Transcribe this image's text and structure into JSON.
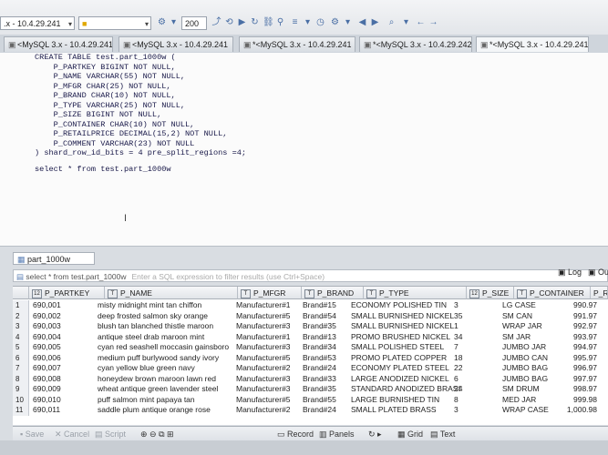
{
  "toolbar": {
    "connection_combo": ".x - 10.4.29.241",
    "database_combo": "",
    "limit_value": "200"
  },
  "tabs": [
    {
      "label": "<MySQL 3.x - 10.4.29.241"
    },
    {
      "label": "<MySQL 3.x - 10.4.29.241"
    },
    {
      "label": "*<MySQL 3.x - 10.4.29.241"
    },
    {
      "label": "*<MySQL 3.x - 10.4.29.242"
    },
    {
      "label": "*<MySQL 3.x - 10.4.29.241"
    }
  ],
  "editor": {
    "lines": [
      "CREATE TABLE test.part_1000w (",
      "    P_PARTKEY BIGINT NOT NULL,",
      "    P_NAME VARCHAR(55) NOT NULL,",
      "    P_MFGR CHAR(25) NOT NULL,",
      "    P_BRAND CHAR(10) NOT NULL,",
      "    P_TYPE VARCHAR(25) NOT NULL,",
      "    P_SIZE BIGINT NOT NULL,",
      "    P_CONTAINER CHAR(10) NOT NULL,",
      "    P_RETAILPRICE DECIMAL(15,2) NOT NULL,",
      "    P_COMMENT VARCHAR(23) NOT NULL",
      ") shard_row_id_bits = 4 pre_split_regions =4;",
      "",
      "select * from test.part_1000w"
    ]
  },
  "result": {
    "tab_label": "part_1000w",
    "filter_query": "select * from test.part_1000w",
    "filter_placeholder": "Enter a SQL expression to filter results (use Ctrl+Space)",
    "log_label": "Log",
    "out_label": "Out",
    "columns": [
      "P_PARTKEY",
      "P_NAME",
      "P_MFGR",
      "P_BRAND",
      "P_TYPE",
      "P_SIZE",
      "P_CONTAINER",
      "P_RET"
    ],
    "rows": [
      [
        "1",
        "690,001",
        "misty midnight mint tan chiffon",
        "Manufacturer#1",
        "Brand#15",
        "ECONOMY POLISHED TIN",
        "3",
        "LG CASE",
        "990.97"
      ],
      [
        "2",
        "690,002",
        "deep frosted salmon sky orange",
        "Manufacturer#5",
        "Brand#54",
        "SMALL BURNISHED NICKEL",
        "35",
        "SM CAN",
        "991.97"
      ],
      [
        "3",
        "690,003",
        "blush tan blanched thistle maroon",
        "Manufacturer#3",
        "Brand#35",
        "SMALL BURNISHED NICKEL",
        "1",
        "WRAP JAR",
        "992.97"
      ],
      [
        "4",
        "690,004",
        "antique steel drab maroon mint",
        "Manufacturer#1",
        "Brand#13",
        "PROMO BRUSHED NICKEL",
        "34",
        "SM JAR",
        "993.97"
      ],
      [
        "5",
        "690,005",
        "cyan red seashell moccasin gainsboro",
        "Manufacturer#3",
        "Brand#34",
        "SMALL POLISHED STEEL",
        "7",
        "JUMBO JAR",
        "994.97"
      ],
      [
        "6",
        "690,006",
        "medium puff burlywood sandy ivory",
        "Manufacturer#5",
        "Brand#53",
        "PROMO PLATED COPPER",
        "18",
        "JUMBO CAN",
        "995.97"
      ],
      [
        "7",
        "690,007",
        "cyan yellow blue green navy",
        "Manufacturer#2",
        "Brand#24",
        "ECONOMY PLATED STEEL",
        "22",
        "JUMBO BAG",
        "996.97"
      ],
      [
        "8",
        "690,008",
        "honeydew brown maroon lawn red",
        "Manufacturer#3",
        "Brand#33",
        "LARGE ANODIZED NICKEL",
        "6",
        "JUMBO BAG",
        "997.97"
      ],
      [
        "9",
        "690,009",
        "wheat antique green lavender steel",
        "Manufacturer#3",
        "Brand#35",
        "STANDARD ANODIZED BRASS",
        "24",
        "SM DRUM",
        "998.97"
      ],
      [
        "10",
        "690,010",
        "puff salmon mint papaya tan",
        "Manufacturer#5",
        "Brand#55",
        "LARGE BURNISHED TIN",
        "8",
        "MED JAR",
        "999.98"
      ],
      [
        "11",
        "690,011",
        "saddle plum antique orange rose",
        "Manufacturer#2",
        "Brand#24",
        "SMALL PLATED BRASS",
        "3",
        "WRAP CASE",
        "1,000.98"
      ]
    ]
  },
  "bottombar": {
    "save": "Save",
    "cancel": "Cancel",
    "script": "Script",
    "record": "Record",
    "panels": "Panels",
    "grid": "Grid",
    "text": "Text"
  }
}
